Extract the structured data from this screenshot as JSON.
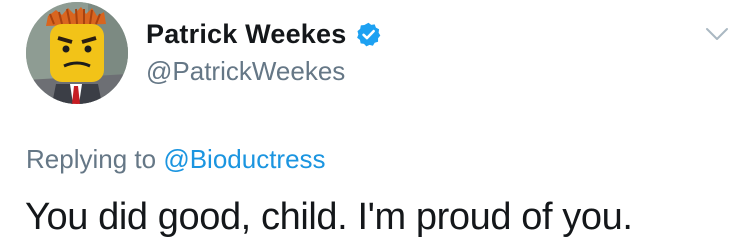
{
  "author": {
    "display_name": "Patrick Weekes",
    "handle": "@PatrickWeekes",
    "verified": true,
    "avatar": "lego-minifigure-avatar"
  },
  "reply": {
    "prefix": "Replying to",
    "target": "@Bioductress"
  },
  "tweet": {
    "text": "You did good, child. I'm proud of you."
  },
  "icons": {
    "verified": "verified-badge-icon",
    "caret": "chevron-down-icon"
  },
  "colors": {
    "text": "#14171a",
    "secondary": "#657786",
    "link": "#1b95e0",
    "verified": "#1da1f2",
    "caret": "#aab8c2"
  }
}
